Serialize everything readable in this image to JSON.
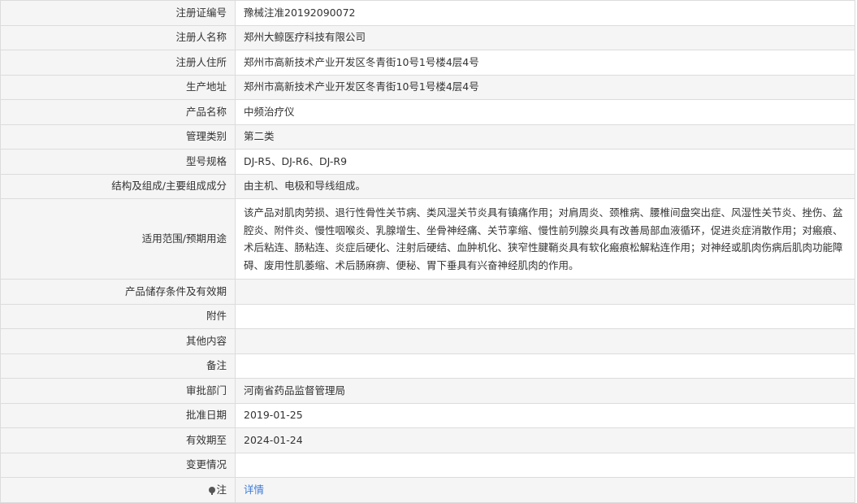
{
  "rows": [
    {
      "label": "注册证编号",
      "value": "豫械注准20192090072"
    },
    {
      "label": "注册人名称",
      "value": "郑州大鲸医疗科技有限公司"
    },
    {
      "label": "注册人住所",
      "value": "郑州市高新技术产业开发区冬青街10号1号楼4层4号"
    },
    {
      "label": "生产地址",
      "value": "郑州市高新技术产业开发区冬青街10号1号楼4层4号"
    },
    {
      "label": "产品名称",
      "value": "中频治疗仪"
    },
    {
      "label": "管理类别",
      "value": "第二类"
    },
    {
      "label": "型号规格",
      "value": "DJ-R5、DJ-R6、DJ-R9"
    },
    {
      "label": "结构及组成/主要组成成分",
      "value": "由主机、电极和导线组成。"
    },
    {
      "label": "适用范围/预期用途",
      "value": "该产品对肌肉劳损、退行性骨性关节病、类风湿关节炎具有镇痛作用；对肩周炎、颈椎病、腰椎间盘突出症、风湿性关节炎、挫伤、盆腔炎、附件炎、慢性咽喉炎、乳腺增生、坐骨神经痛、关节挛缩、慢性前列腺炎具有改善局部血液循环，促进炎症消散作用；对瘢痕、术后粘连、肠粘连、炎症后硬化、注射后硬结、血肿机化、狭窄性腱鞘炎具有软化瘢痕松解粘连作用；对神经或肌肉伤病后肌肉功能障碍、废用性肌萎缩、术后肠麻痹、便秘、胃下垂具有兴奋神经肌肉的作用。"
    },
    {
      "label": "产品储存条件及有效期",
      "value": ""
    },
    {
      "label": "附件",
      "value": ""
    },
    {
      "label": "其他内容",
      "value": ""
    },
    {
      "label": "备注",
      "value": ""
    },
    {
      "label": "审批部门",
      "value": "河南省药品监督管理局"
    },
    {
      "label": "批准日期",
      "value": "2019-01-25"
    },
    {
      "label": "有效期至",
      "value": "2024-01-24"
    },
    {
      "label": "变更情况",
      "value": ""
    }
  ],
  "note": {
    "label": "注",
    "link_text": "详情",
    "icon": "pin-icon",
    "link_color": "#3a7ad8"
  }
}
